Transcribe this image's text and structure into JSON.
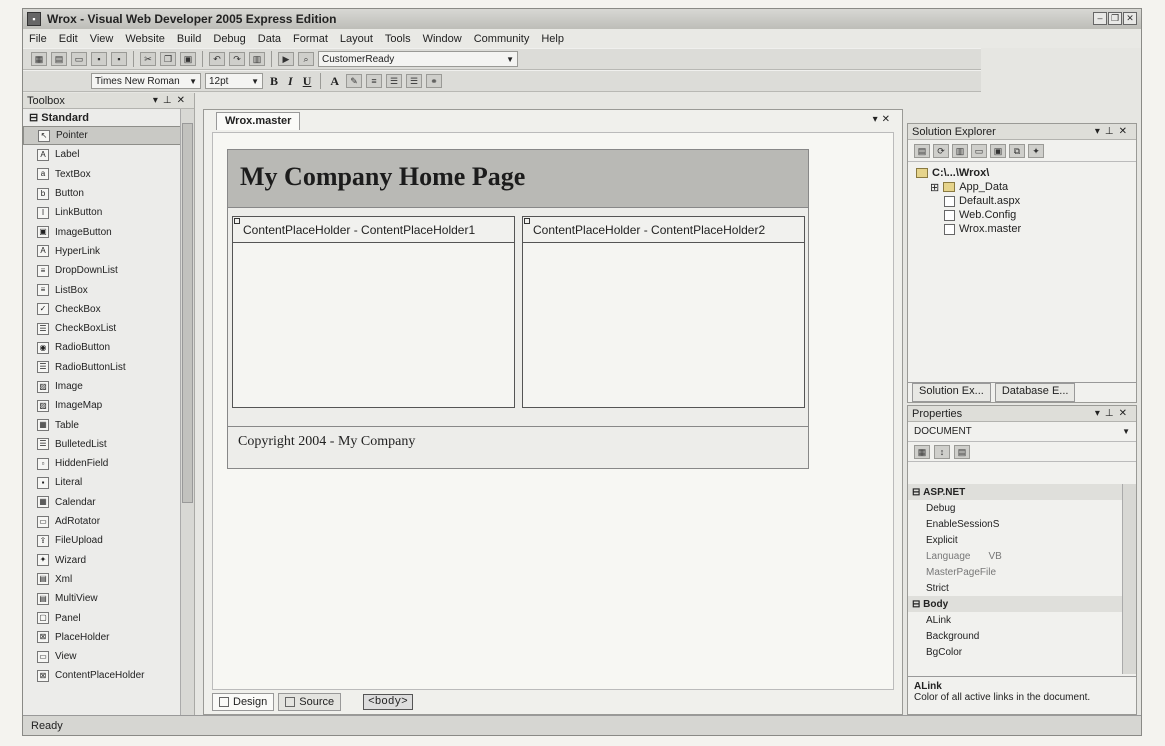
{
  "window": {
    "title": "Wrox - Visual Web Developer 2005 Express Edition",
    "app_icon": "vs-app-icon"
  },
  "menu": [
    "File",
    "Edit",
    "View",
    "Website",
    "Build",
    "Debug",
    "Data",
    "Format",
    "Layout",
    "Tools",
    "Window",
    "Community",
    "Help"
  ],
  "toolbar1": {
    "config_combo": "CustomerReady"
  },
  "toolbar2": {
    "font_combo": "Times New Roman",
    "size_combo": "12pt"
  },
  "toolbox": {
    "title": "Toolbox",
    "group": "Standard",
    "items": [
      "Pointer",
      "Label",
      "TextBox",
      "Button",
      "LinkButton",
      "ImageButton",
      "HyperLink",
      "DropDownList",
      "ListBox",
      "CheckBox",
      "CheckBoxList",
      "RadioButton",
      "RadioButtonList",
      "Image",
      "ImageMap",
      "Table",
      "BulletedList",
      "HiddenField",
      "Literal",
      "Calendar",
      "AdRotator",
      "FileUpload",
      "Wizard",
      "Xml",
      "MultiView",
      "Panel",
      "PlaceHolder",
      "View",
      "ContentPlaceHolder"
    ]
  },
  "document": {
    "tab": "Wrox.master",
    "header_text": "My Company Home Page",
    "cph1": "ContentPlaceHolder - ContentPlaceHolder1",
    "cph2": "ContentPlaceHolder - ContentPlaceHolder2",
    "footer_text": "Copyright 2004 - My Company",
    "view_tabs": [
      "Design",
      "Source"
    ],
    "breadcrumb": "<body>"
  },
  "solution_explorer": {
    "title": "Solution Explorer",
    "root": "C:\\...\\Wrox\\",
    "items": [
      "App_Data",
      "Default.aspx",
      "Web.Config",
      "Wrox.master"
    ],
    "bottom_tabs": [
      "Solution Ex...",
      "Database E..."
    ]
  },
  "properties": {
    "title": "Properties",
    "object": "DOCUMENT",
    "categories": [
      {
        "name": "ASP.NET",
        "rows": [
          {
            "name": "Debug",
            "value": ""
          },
          {
            "name": "EnableSessionS",
            "value": ""
          },
          {
            "name": "Explicit",
            "value": ""
          },
          {
            "name": "Language",
            "value": "VB"
          },
          {
            "name": "MasterPageFile",
            "value": ""
          },
          {
            "name": "Strict",
            "value": ""
          }
        ]
      },
      {
        "name": "Body",
        "rows": [
          {
            "name": "ALink",
            "value": ""
          },
          {
            "name": "Background",
            "value": ""
          },
          {
            "name": "BgColor",
            "value": ""
          }
        ]
      }
    ],
    "desc_title": "ALink",
    "desc_text": "Color of all active links in the document."
  },
  "status": "Ready"
}
